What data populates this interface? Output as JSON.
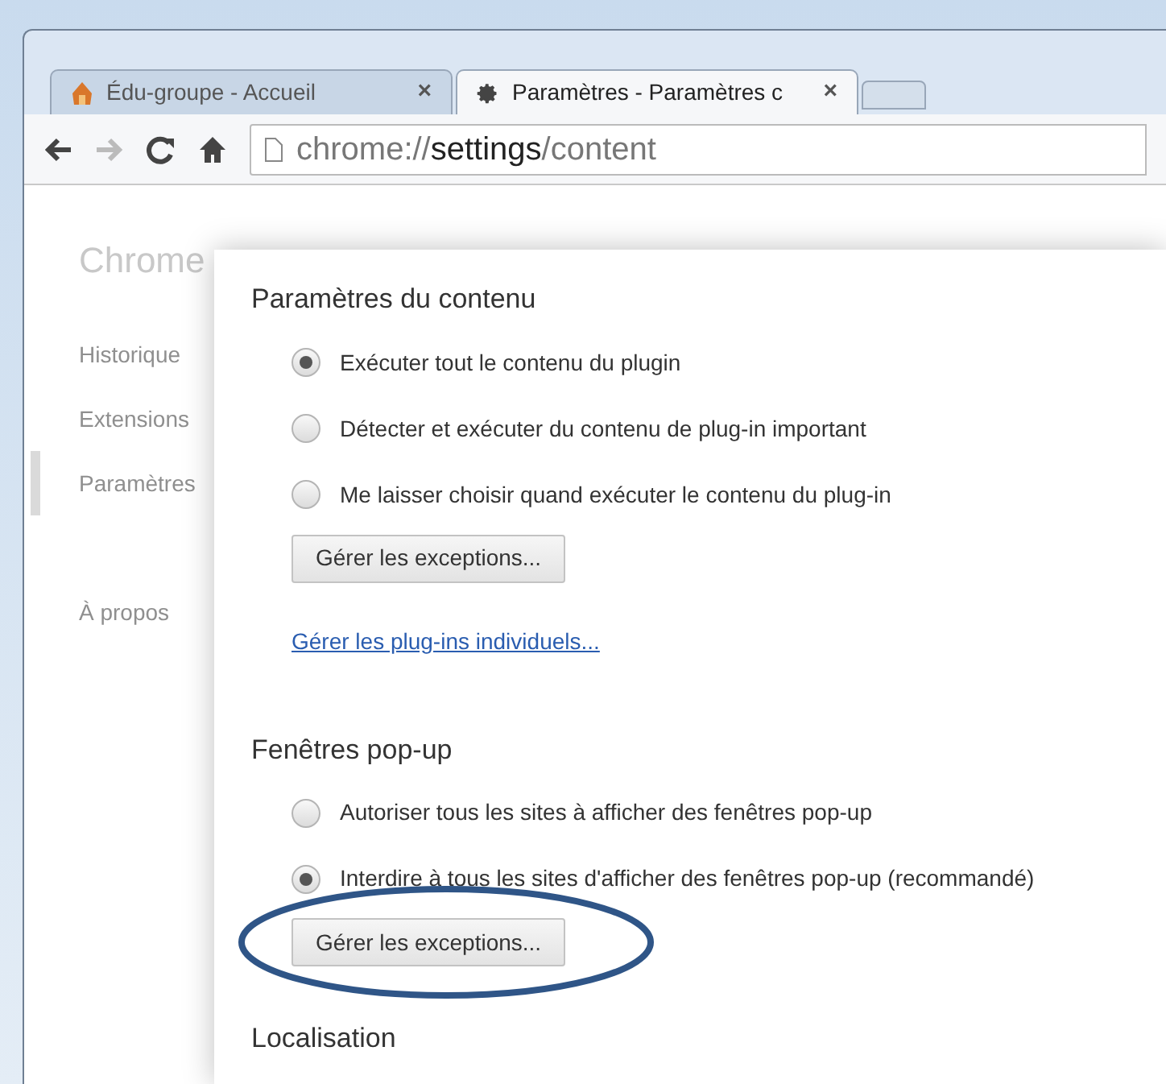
{
  "tabs": [
    {
      "title": "Édu-groupe - Accueil",
      "selected": false,
      "kind": "site",
      "close": "×"
    },
    {
      "title": "Paramètres - Paramètres c",
      "selected": true,
      "kind": "settings",
      "close": "×"
    }
  ],
  "address": {
    "scheme": "chrome://",
    "host": "settings",
    "path": "/content"
  },
  "sidebar": {
    "title": "Chrome",
    "items": [
      {
        "label": "Historique",
        "selected": false
      },
      {
        "label": "Extensions",
        "selected": false
      },
      {
        "label": "Paramètres",
        "selected": true
      }
    ],
    "footer_items": [
      {
        "label": "À propos",
        "selected": false
      }
    ]
  },
  "dialog": {
    "sections": [
      {
        "title": "Paramètres du contenu",
        "options": [
          {
            "label": "Exécuter tout le contenu du plugin",
            "selected": true
          },
          {
            "label": "Détecter et exécuter du contenu de plug-in important",
            "selected": false
          },
          {
            "label": "Me laisser choisir quand exécuter le contenu du plug-in",
            "selected": false
          }
        ],
        "button": "Gérer les exceptions...",
        "highlighted": false,
        "link": "Gérer les plug-ins individuels..."
      },
      {
        "title": "Fenêtres pop-up",
        "options": [
          {
            "label": "Autoriser tous les sites à afficher des fenêtres pop-up",
            "selected": false
          },
          {
            "label": "Interdire à tous les sites d'afficher des fenêtres pop-up (recommandé)",
            "selected": true
          }
        ],
        "button": "Gérer les exceptions...",
        "highlighted": true
      },
      {
        "title": "Localisation"
      }
    ]
  }
}
